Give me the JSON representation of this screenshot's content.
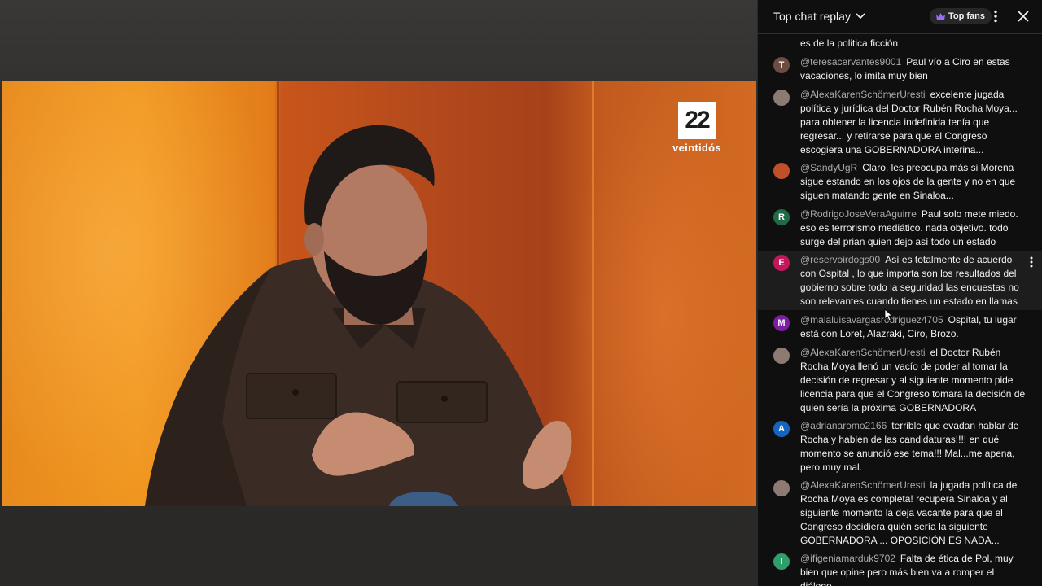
{
  "video": {
    "channel_logo": {
      "number": "22",
      "word": "veintidós"
    },
    "colors": {
      "orange": "#f0961f",
      "burnt": "#b54a1c",
      "jacket": "#3a2b25"
    }
  },
  "chat": {
    "title": "Top chat replay",
    "top_fans_label": "Top fans",
    "icons": {
      "title_dropdown": "chevron-down-icon",
      "top_fans": "crown-icon",
      "more": "more-vert-icon",
      "close": "close-icon"
    },
    "partial_message": "es de la politica ficción",
    "messages": [
      {
        "author": "@teresacervantes9001",
        "text": "Paul vío a Ciro en estas vacaciones, lo imita muy bien",
        "initial": "T",
        "avatar_color": "#6d4c41"
      },
      {
        "author": "@AlexaKarenSchömerUresti",
        "text": "excelente jugada política y jurídica del Doctor Rubén Rocha Moya... para obtener la licencia indefinida tenía que regresar... y retirarse para que el Congreso escogiera una GOBERNADORA interina...",
        "initial": "",
        "avatar_color": "#8d7b73"
      },
      {
        "author": "@SandyUgR",
        "text": "Claro, les preocupa más si Morena sigue estando en los ojos de la gente y no en que siguen matando gente en Sinaloa...",
        "initial": "",
        "avatar_color": "#c0502a"
      },
      {
        "author": "@RodrigoJoseVeraAguirre",
        "text": "Paul solo mete miedo. eso es terrorismo mediático. nada objetivo. todo surge del prian quien dejo así todo un estado",
        "initial": "R",
        "avatar_color": "#1e6b45"
      },
      {
        "author": "@reservoirdogs00",
        "text": "Así es totalmente de acuerdo con Ospital , lo que importa son los resultados del gobierno sobre todo la seguridad las encuestas no son relevantes cuando tienes un estado en llamas",
        "initial": "E",
        "avatar_color": "#c2185b"
      },
      {
        "author": "@malaluisavargasrodriguez4705",
        "text": "Ospital, tu lugar está con Loret, Alazraki, Ciro, Brozo.",
        "initial": "M",
        "avatar_color": "#7b1fa2"
      },
      {
        "author": "@AlexaKarenSchömerUresti",
        "text": "el Doctor Rubén Rocha Moya llenó un vacío de poder al tomar la decisión de regresar y al siguiente momento pide licencia para que el Congreso tomara la decisión de quien sería la próxima GOBERNADORA",
        "initial": "",
        "avatar_color": "#8d7b73"
      },
      {
        "author": "@adrianaromo2166",
        "text": "terrible que evadan hablar de Rocha y hablen de las candidaturas!!!! en qué momento se anunció ese tema!!! Mal...me apena, pero muy mal.",
        "initial": "A",
        "avatar_color": "#1565c0"
      },
      {
        "author": "@AlexaKarenSchömerUresti",
        "text": "la jugada política de Rocha Moya es completa! recupera Sinaloa y al siguiente momento la deja vacante para que el Congreso decidiera quién sería la siguiente GOBERNADORA ... OPOSICIÓN ES NADA...",
        "initial": "",
        "avatar_color": "#8d7b73"
      },
      {
        "author": "@ifigeniamarduk9702",
        "text": "Falta de ética de Pol, muy bien que opine pero más bien va a romper el diálogo",
        "initial": "I",
        "avatar_color": "#2e9e6b"
      }
    ]
  }
}
